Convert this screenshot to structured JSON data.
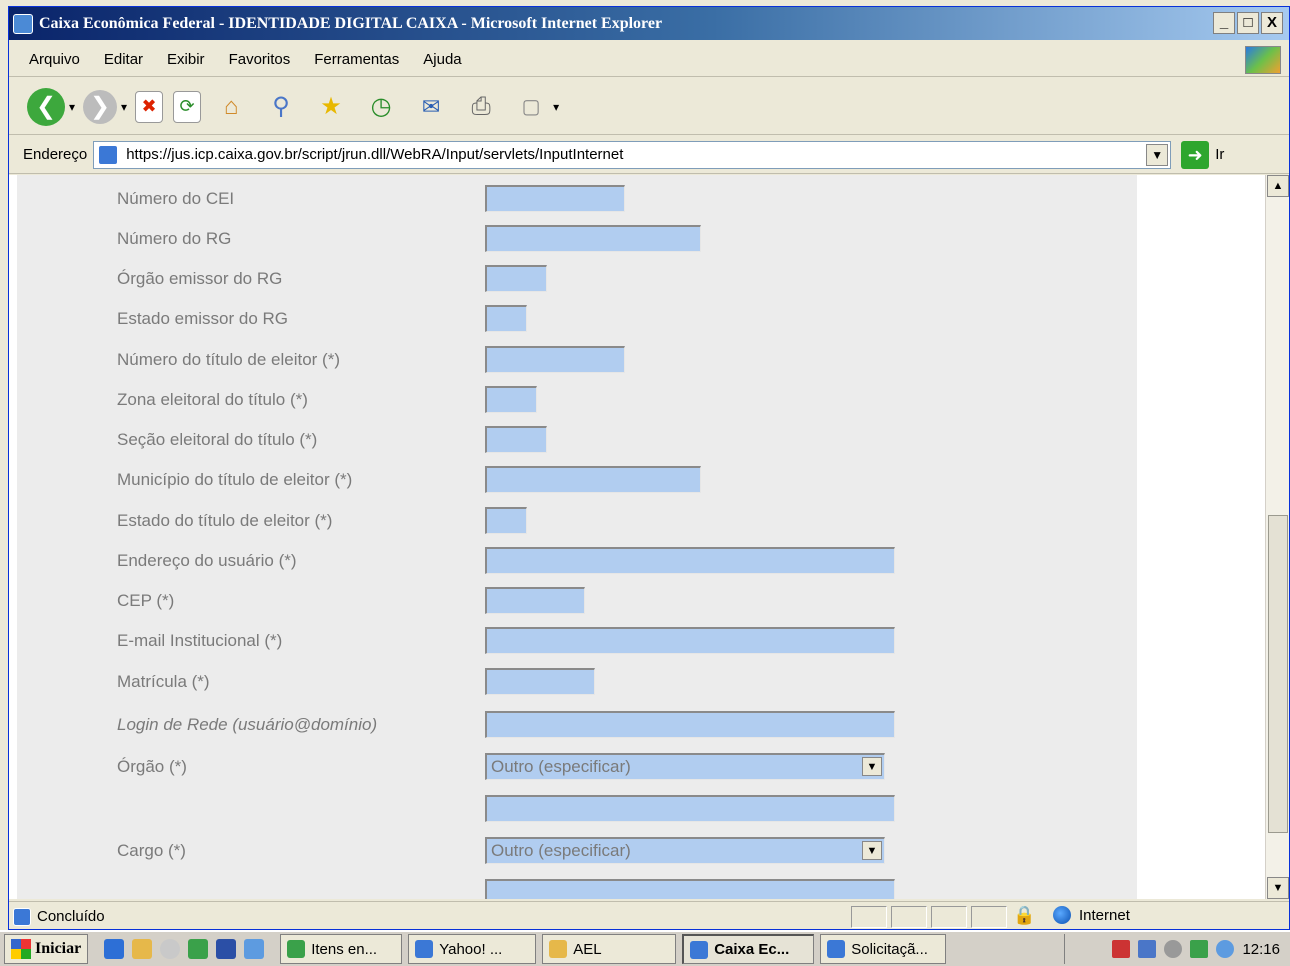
{
  "window": {
    "title": "Caixa Econômica Federal - IDENTIDADE DIGITAL CAIXA - Microsoft Internet Explorer",
    "buttons": [
      "_",
      "□",
      "X"
    ]
  },
  "menu": [
    "Arquivo",
    "Editar",
    "Exibir",
    "Favoritos",
    "Ferramentas",
    "Ajuda"
  ],
  "toolbar": {
    "back_icon": "back-arrow-icon",
    "forward_icon": "forward-arrow-icon",
    "stop_icon": "stop-icon",
    "refresh_icon": "refresh-icon",
    "home_icon": "home-icon",
    "search_icon": "search-icon",
    "favorites_icon": "favorites-star-icon",
    "history_icon": "history-icon",
    "mail_icon": "mail-icon",
    "print_icon": "print-icon",
    "edit_icon": "edit-icon"
  },
  "address": {
    "label": "Endereço",
    "url": "https://jus.icp.caixa.gov.br/script/jrun.dll/WebRA/Input/servlets/InputInternet",
    "go_label": "Ir"
  },
  "form": {
    "fields": [
      {
        "label": "Número do CEI",
        "value": ""
      },
      {
        "label": "Número do RG",
        "value": ""
      },
      {
        "label": "Órgão emissor do RG",
        "value": ""
      },
      {
        "label": "Estado emissor do RG",
        "value": ""
      },
      {
        "label": "Número do título de eleitor (*)",
        "value": ""
      },
      {
        "label": "Zona eleitoral do título (*)",
        "value": ""
      },
      {
        "label": "Seção eleitoral do título (*)",
        "value": ""
      },
      {
        "label": "Município do título de eleitor (*)",
        "value": ""
      },
      {
        "label": "Estado do título de eleitor (*)",
        "value": ""
      },
      {
        "label": "Endereço do usuário (*)",
        "value": ""
      },
      {
        "label": "CEP (*)",
        "value": ""
      },
      {
        "label": "E-mail Institucional (*)",
        "value": ""
      },
      {
        "label": "Matrícula (*)",
        "value": ""
      },
      {
        "label": "Login de Rede (usuário@domínio)",
        "value": ""
      }
    ],
    "orgao": {
      "label": "Órgão (*)",
      "selected": "Outro (especificar)",
      "other_value": ""
    },
    "cargo": {
      "label": "Cargo (*)",
      "selected": "Outro (especificar)",
      "other_value": ""
    }
  },
  "colors": {
    "field_fill": "#b1cdf0",
    "panel_bg": "#ececec",
    "label_text": "#7a7a7a"
  },
  "status": {
    "text": "Concluído",
    "zone": "Internet"
  },
  "taskbar": {
    "start": "Iniciar",
    "tasks": [
      "Itens en...",
      "Yahoo! ...",
      "AEL",
      "Caixa Ec...",
      "Solicitaçã..."
    ],
    "active_task": "Caixa Ec...",
    "clock": "12:16"
  }
}
